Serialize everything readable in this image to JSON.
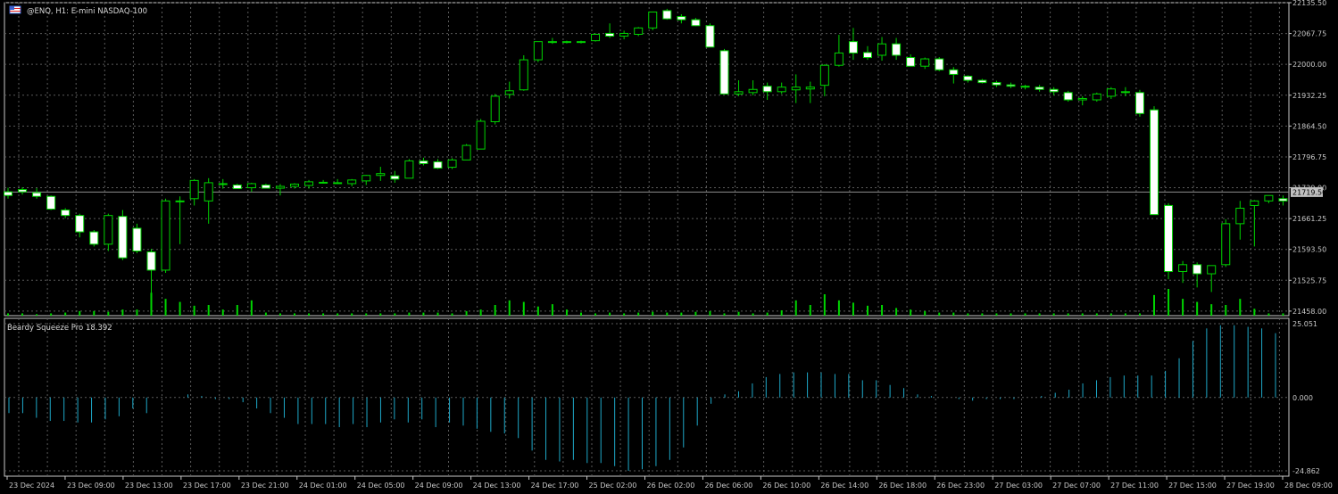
{
  "chart_title": "@ENQ, H1:  E-mini NASDAQ-100",
  "indicator_title": "Beardy Squeeze Pro 18.392",
  "colors": {
    "background": "#000000",
    "grid": "#5a5a5a",
    "axis": "#c8c8c8",
    "candle_outline": "#00d400",
    "candle_up": "#000000",
    "candle_down": "#ffffff",
    "volume": "#00d400",
    "histogram": "#1ea8c8",
    "current_price_line": "#8c8c8c",
    "current_price_label_bg": "#c0c0c0",
    "current_price_label_text": "#000000"
  },
  "icons": {
    "flag": "flag-icon"
  },
  "chart_data": [
    {
      "type": "candlestick",
      "symbol": "@ENQ",
      "timeframe": "H1",
      "price_axis_labels": [
        "22135.50",
        "22067.75",
        "22000.00",
        "21932.25",
        "21864.50",
        "21796.75",
        "21729.00",
        "21661.25",
        "21593.50",
        "21525.75",
        "21458.00"
      ],
      "ylim": [
        21448,
        22135.5
      ],
      "current_price": "21719.50",
      "time_axis_labels": [
        "23 Dec 2024",
        "23 Dec 09:00",
        "23 Dec 13:00",
        "23 Dec 17:00",
        "23 Dec 21:00",
        "24 Dec 01:00",
        "24 Dec 05:00",
        "24 Dec 09:00",
        "24 Dec 13:00",
        "24 Dec 17:00",
        "25 Dec 02:00",
        "26 Dec 02:00",
        "26 Dec 06:00",
        "26 Dec 10:00",
        "26 Dec 14:00",
        "26 Dec 18:00",
        "26 Dec 23:00",
        "27 Dec 03:00",
        "27 Dec 07:00",
        "27 Dec 11:00",
        "27 Dec 15:00",
        "27 Dec 19:00",
        "28 Dec 09:00"
      ],
      "ohlc": [
        [
          21720,
          21729,
          21705,
          21712
        ],
        [
          21725,
          21730,
          21714,
          21720
        ],
        [
          21718,
          21728,
          21705,
          21710
        ],
        [
          21710,
          21712,
          21680,
          21682
        ],
        [
          21680,
          21684,
          21662,
          21668
        ],
        [
          21668,
          21672,
          21620,
          21632
        ],
        [
          21632,
          21636,
          21600,
          21605
        ],
        [
          21605,
          21672,
          21590,
          21668
        ],
        [
          21666,
          21680,
          21570,
          21575
        ],
        [
          21640,
          21650,
          21585,
          21590
        ],
        [
          21588,
          21595,
          21472,
          21548
        ],
        [
          21548,
          21705,
          21542,
          21700
        ],
        [
          21700,
          21710,
          21605,
          21700
        ],
        [
          21705,
          21748,
          21690,
          21745
        ],
        [
          21700,
          21750,
          21650,
          21740
        ],
        [
          21738,
          21748,
          21727,
          21736
        ],
        [
          21735,
          21738,
          21727,
          21727
        ],
        [
          21729,
          21740,
          21720,
          21738
        ],
        [
          21735,
          21738,
          21728,
          21728
        ],
        [
          21728,
          21737,
          21712,
          21732
        ],
        [
          21732,
          21739,
          21727,
          21737
        ],
        [
          21734,
          21746,
          21727,
          21742
        ],
        [
          21740,
          21746,
          21738,
          21741
        ],
        [
          21740,
          21748,
          21738,
          21740
        ],
        [
          21738,
          21748,
          21732,
          21746
        ],
        [
          21744,
          21757,
          21735,
          21756
        ],
        [
          21756,
          21775,
          21744,
          21760
        ],
        [
          21755,
          21766,
          21740,
          21748
        ],
        [
          21750,
          21792,
          21750,
          21788
        ],
        [
          21788,
          21795,
          21778,
          21782
        ],
        [
          21786,
          21792,
          21770,
          21772
        ],
        [
          21774,
          21794,
          21770,
          21790
        ],
        [
          21790,
          21825,
          21790,
          21822
        ],
        [
          21814,
          21880,
          21814,
          21875
        ],
        [
          21874,
          21935,
          21868,
          21930
        ],
        [
          21934,
          21962,
          21925,
          21942
        ],
        [
          21944,
          22020,
          21942,
          22010
        ],
        [
          22010,
          22050,
          22005,
          22050
        ],
        [
          22050,
          22058,
          22045,
          22050
        ],
        [
          22050,
          22052,
          22046,
          22050
        ],
        [
          22050,
          22052,
          22046,
          22050
        ],
        [
          22052,
          22068,
          22050,
          22066
        ],
        [
          22068,
          22090,
          22058,
          22062
        ],
        [
          22062,
          22074,
          22055,
          22068
        ],
        [
          22066,
          22082,
          22062,
          22080
        ],
        [
          22080,
          22116,
          22075,
          22115
        ],
        [
          22118,
          22122,
          22098,
          22100
        ],
        [
          22105,
          22110,
          22090,
          22098
        ],
        [
          22098,
          22102,
          22084,
          22085
        ],
        [
          22085,
          22090,
          22038,
          22038
        ],
        [
          22030,
          22034,
          21960,
          21935
        ],
        [
          21935,
          21965,
          21930,
          21940
        ],
        [
          21938,
          21965,
          21932,
          21945
        ],
        [
          21952,
          21960,
          21922,
          21940
        ],
        [
          21940,
          21960,
          21935,
          21950
        ],
        [
          21944,
          21978,
          21915,
          21950
        ],
        [
          21946,
          21962,
          21915,
          21950
        ],
        [
          21954,
          22000,
          21930,
          21998
        ],
        [
          21998,
          22065,
          21995,
          22025
        ],
        [
          22050,
          22080,
          22010,
          22025
        ],
        [
          22026,
          22040,
          22010,
          22015
        ],
        [
          22020,
          22060,
          22008,
          22045
        ],
        [
          22045,
          22058,
          22010,
          22020
        ],
        [
          22015,
          22022,
          21996,
          21996
        ],
        [
          21996,
          22015,
          21990,
          22012
        ],
        [
          22012,
          22016,
          21985,
          21988
        ],
        [
          21988,
          21994,
          21958,
          21978
        ],
        [
          21974,
          21976,
          21960,
          21965
        ],
        [
          21965,
          21968,
          21958,
          21960
        ],
        [
          21960,
          21964,
          21950,
          21955
        ],
        [
          21955,
          21960,
          21948,
          21952
        ],
        [
          21952,
          21955,
          21945,
          21950
        ],
        [
          21950,
          21955,
          21940,
          21945
        ],
        [
          21945,
          21950,
          21932,
          21940
        ],
        [
          21938,
          21942,
          21918,
          21922
        ],
        [
          21922,
          21930,
          21910,
          21925
        ],
        [
          21922,
          21938,
          21918,
          21935
        ],
        [
          21930,
          21950,
          21924,
          21946
        ],
        [
          21940,
          21950,
          21930,
          21938
        ],
        [
          21938,
          21944,
          21885,
          21892
        ],
        [
          21900,
          21908,
          21815,
          21670
        ],
        [
          21690,
          21695,
          21528,
          21545
        ],
        [
          21545,
          21568,
          21520,
          21560
        ],
        [
          21560,
          21565,
          21510,
          21540
        ],
        [
          21540,
          21558,
          21500,
          21558
        ],
        [
          21560,
          21660,
          21555,
          21650
        ],
        [
          21650,
          21700,
          21615,
          21684
        ],
        [
          21690,
          21702,
          21600,
          21700
        ],
        [
          21700,
          21712,
          21695,
          21712
        ],
        [
          21705,
          21712,
          21690,
          21700
        ]
      ],
      "volume": [
        3,
        3,
        2,
        3,
        4,
        6,
        6,
        5,
        8,
        8,
        30,
        22,
        18,
        13,
        14,
        8,
        14,
        20,
        4,
        3,
        3,
        3,
        3,
        3,
        3,
        3,
        3,
        3,
        4,
        4,
        4,
        3,
        6,
        8,
        14,
        20,
        18,
        12,
        15,
        8,
        4,
        3,
        4,
        3,
        4,
        5,
        4,
        4,
        5,
        6,
        3,
        5,
        3,
        4,
        7,
        20,
        14,
        28,
        20,
        17,
        13,
        14,
        10,
        8,
        6,
        4,
        4,
        3,
        3,
        3,
        3,
        3,
        3,
        3,
        3,
        3,
        3,
        3,
        3,
        3,
        27,
        35,
        22,
        18,
        15,
        14,
        22,
        9,
        3,
        3
      ],
      "volume_scale_note": "relative heights"
    },
    {
      "type": "bar",
      "series": [
        {
          "name": "Beardy Squeeze Pro 18.392",
          "values": [
            -10,
            -10,
            -13,
            -15,
            -15,
            -16,
            -16,
            -14,
            -12,
            -7,
            -10,
            0,
            0,
            2,
            1,
            -1,
            -1,
            -3,
            -7,
            -10,
            -13,
            -17,
            -17,
            -17,
            -19,
            -17,
            -19,
            -16,
            -14,
            -16,
            -14,
            -19,
            -16,
            -18,
            -20,
            -22,
            -23,
            -26,
            -34,
            -40,
            -41,
            -40,
            -42,
            -42,
            -44,
            -47,
            -46,
            -44,
            -40,
            -32,
            -18,
            -4,
            2,
            4,
            9,
            13,
            15,
            16,
            16,
            16,
            15,
            15,
            11,
            11,
            8,
            6,
            2,
            1,
            0,
            -1,
            -2,
            -1,
            -1,
            -1,
            0,
            1,
            3,
            5,
            9,
            11,
            13,
            14,
            14,
            14,
            17,
            25,
            36,
            44,
            46,
            46,
            45,
            44,
            41
          ]
        }
      ],
      "ylim": [
        -24.862,
        25.051
      ],
      "axis_labels": [
        "25.051",
        "0.000",
        "-24.862"
      ],
      "grid": true
    }
  ]
}
